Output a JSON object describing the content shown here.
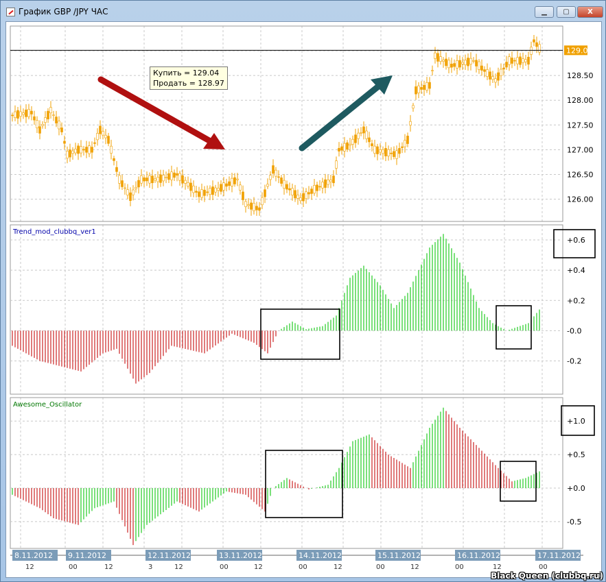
{
  "window": {
    "title": "График GBP /JPY  ЧАС",
    "min": "▁",
    "max": "▢",
    "close": "X"
  },
  "tooltip": {
    "buy": "Купить = 129.04",
    "sell": "Продать = 128.97"
  },
  "watermark": "Black Queen (clubbq.ru)",
  "colors": {
    "candle": "#f0a000",
    "up": "#22cc22",
    "down": "#cc2222",
    "grid": "#c8c8c8",
    "price_label": "#f0a000"
  },
  "chart_data": [
    {
      "type": "candlestick",
      "name": "GBP/JPY H1",
      "current_price_label": "129.01",
      "current_price": 129.01,
      "yticks": [
        126.0,
        126.5,
        127.0,
        127.5,
        128.0,
        128.5,
        129.0
      ],
      "ytick_labels": [
        "126.00",
        "126.50",
        "127.00",
        "127.50",
        "128.00",
        "128.50",
        ""
      ],
      "ylim": [
        125.55,
        129.5
      ],
      "bars": 193,
      "path": [
        [
          0,
          127.7
        ],
        [
          7,
          127.75
        ],
        [
          10,
          127.4
        ],
        [
          14,
          127.8
        ],
        [
          18,
          127.4
        ],
        [
          20,
          126.9
        ],
        [
          24,
          127.0
        ],
        [
          29,
          127.0
        ],
        [
          32,
          127.4
        ],
        [
          35,
          127.2
        ],
        [
          39,
          126.4
        ],
        [
          43,
          126.05
        ],
        [
          47,
          126.4
        ],
        [
          53,
          126.4
        ],
        [
          60,
          126.5
        ],
        [
          68,
          126.1
        ],
        [
          75,
          126.2
        ],
        [
          82,
          126.4
        ],
        [
          85,
          125.9
        ],
        [
          90,
          125.8
        ],
        [
          95,
          126.6
        ],
        [
          99,
          126.3
        ],
        [
          105,
          126.0
        ],
        [
          110,
          126.2
        ],
        [
          117,
          126.4
        ],
        [
          119,
          127.0
        ],
        [
          123,
          127.1
        ],
        [
          128,
          127.4
        ],
        [
          132,
          127.0
        ],
        [
          140,
          126.9
        ],
        [
          144,
          127.2
        ],
        [
          147,
          128.2
        ],
        [
          152,
          128.3
        ],
        [
          154,
          128.9
        ],
        [
          160,
          128.7
        ],
        [
          168,
          128.8
        ],
        [
          170,
          128.7
        ],
        [
          176,
          128.4
        ],
        [
          181,
          128.8
        ],
        [
          188,
          128.8
        ],
        [
          190,
          129.2
        ],
        [
          192,
          129.05
        ]
      ]
    },
    {
      "type": "histogram",
      "title": "Trend_mod_clubbq_ver1",
      "yticks": [
        -0.2,
        0.0,
        0.2,
        0.4,
        0.6
      ],
      "ytick_labels": [
        "-0.2",
        "-0.0",
        "+0.2",
        "+0.4",
        "+0.6"
      ],
      "ylim": [
        -0.42,
        0.7
      ],
      "path": [
        [
          0,
          -0.1
        ],
        [
          10,
          -0.2
        ],
        [
          25,
          -0.27
        ],
        [
          33,
          -0.15
        ],
        [
          38,
          -0.12
        ],
        [
          45,
          -0.35
        ],
        [
          50,
          -0.28
        ],
        [
          58,
          -0.1
        ],
        [
          70,
          -0.15
        ],
        [
          80,
          -0.02
        ],
        [
          88,
          -0.08
        ],
        [
          93,
          -0.15
        ],
        [
          97,
          0
        ],
        [
          102,
          0.06
        ],
        [
          107,
          0.01
        ],
        [
          113,
          0.03
        ],
        [
          118,
          0.1
        ],
        [
          123,
          0.35
        ],
        [
          128,
          0.43
        ],
        [
          134,
          0.3
        ],
        [
          139,
          0.15
        ],
        [
          144,
          0.25
        ],
        [
          152,
          0.55
        ],
        [
          157,
          0.64
        ],
        [
          163,
          0.45
        ],
        [
          170,
          0.15
        ],
        [
          175,
          0.05
        ],
        [
          180,
          0.0
        ],
        [
          188,
          0.05
        ],
        [
          192,
          0.14
        ]
      ]
    },
    {
      "type": "histogram",
      "title": "Awesome_Oscillator",
      "yticks": [
        -0.5,
        0.0,
        0.5,
        1.0
      ],
      "ytick_labels": [
        "-0.5",
        "+0.0",
        "+0.5",
        "+1.0"
      ],
      "ylim": [
        -0.9,
        1.35
      ],
      "path": [
        [
          0,
          -0.1
        ],
        [
          10,
          -0.3
        ],
        [
          15,
          -0.45
        ],
        [
          24,
          -0.55
        ],
        [
          30,
          -0.3
        ],
        [
          37,
          -0.2
        ],
        [
          44,
          -0.85
        ],
        [
          49,
          -0.55
        ],
        [
          60,
          -0.2
        ],
        [
          68,
          -0.35
        ],
        [
          78,
          -0.05
        ],
        [
          85,
          -0.1
        ],
        [
          92,
          -0.35
        ],
        [
          95,
          0
        ],
        [
          100,
          0.15
        ],
        [
          108,
          -0.02
        ],
        [
          115,
          0.05
        ],
        [
          119,
          0.3
        ],
        [
          124,
          0.7
        ],
        [
          130,
          0.8
        ],
        [
          137,
          0.5
        ],
        [
          145,
          0.3
        ],
        [
          152,
          0.9
        ],
        [
          157,
          1.2
        ],
        [
          163,
          0.9
        ],
        [
          170,
          0.6
        ],
        [
          177,
          0.3
        ],
        [
          182,
          0.1
        ],
        [
          187,
          0.15
        ],
        [
          192,
          0.25
        ]
      ]
    }
  ],
  "time_axis": {
    "dates": [
      "8.11.2012",
      "9.11.2012",
      "12.11.2012",
      "13.11.2012",
      "14.11.2012",
      "15.11.2012",
      "16.11.2012",
      "17.11.2012"
    ],
    "hours": [
      "12",
      "00",
      "12",
      "3",
      "12",
      "00",
      "12",
      "00",
      "12",
      "00",
      "12",
      "00",
      "12",
      "00"
    ]
  }
}
